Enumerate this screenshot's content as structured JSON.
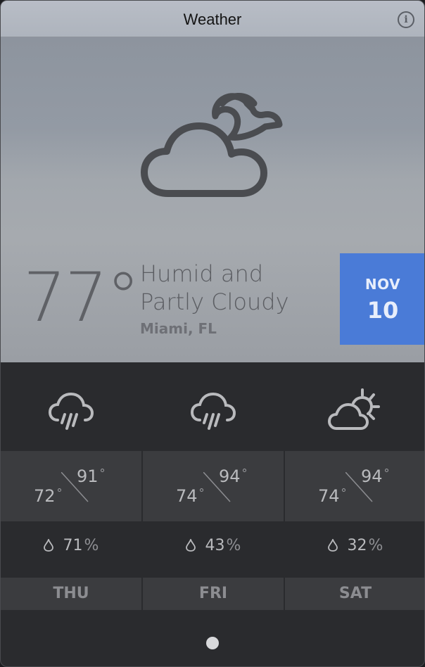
{
  "window": {
    "title": "Weather"
  },
  "current": {
    "temperature": "77°",
    "condition": "Humid and Partly Cloudy",
    "location": "Miami, FL",
    "icon": "partly-cloudy-night-icon"
  },
  "date": {
    "month": "NOV",
    "day": "10"
  },
  "forecast": [
    {
      "day": "THU",
      "high": "91",
      "low": "72",
      "precip": "71",
      "icon": "rain-icon"
    },
    {
      "day": "FRI",
      "high": "94",
      "low": "74",
      "precip": "43",
      "icon": "rain-icon"
    },
    {
      "day": "SAT",
      "high": "94",
      "low": "74",
      "precip": "32",
      "icon": "partly-cloudy-day-icon"
    }
  ],
  "units": {
    "degree": "°",
    "percent": "%"
  },
  "colors": {
    "date_badge": "#4a7bd7",
    "panel": "#2a2b2e",
    "cell": "#3b3c3f"
  },
  "pagination": {
    "pages": 1,
    "active": 1
  }
}
